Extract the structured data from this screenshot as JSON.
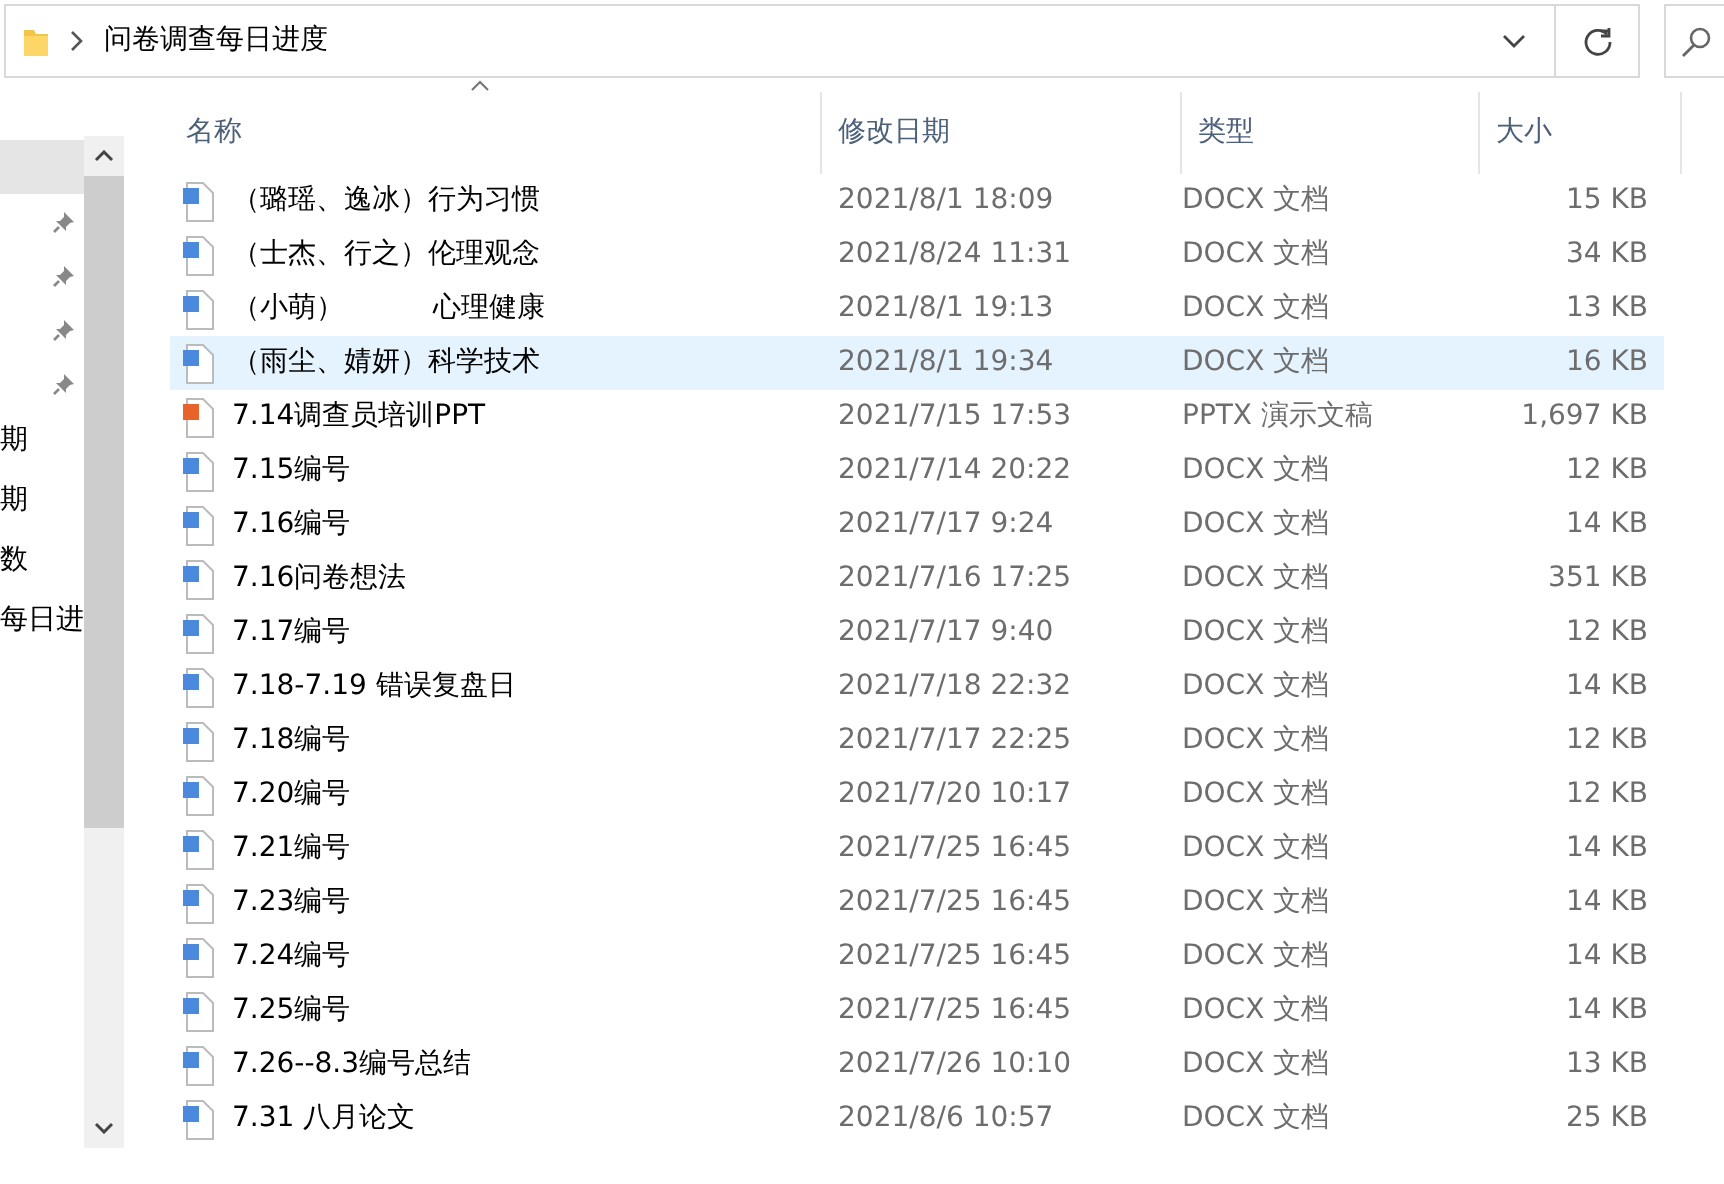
{
  "address_bar": {
    "path": "问卷调查每日进度"
  },
  "sidebar": {
    "items": [
      {
        "selected": true,
        "pinned": false
      },
      {
        "selected": false,
        "pinned": true
      },
      {
        "selected": false,
        "pinned": true
      },
      {
        "selected": false,
        "pinned": true
      },
      {
        "selected": false,
        "pinned": true
      },
      {
        "selected": false,
        "pinned": false,
        "label": "期"
      },
      {
        "selected": false,
        "pinned": false,
        "label": "期"
      },
      {
        "selected": false,
        "pinned": false,
        "label": "数"
      },
      {
        "selected": false,
        "pinned": false,
        "label": "每日进"
      }
    ]
  },
  "table": {
    "columns": [
      "名称",
      "修改日期",
      "类型",
      "大小"
    ],
    "rows": [
      {
        "kind": "docx",
        "name": "（璐瑶、逸冰）行为习惯",
        "modified": "2021/8/1 18:09",
        "type": "DOCX 文档",
        "size": "15 KB",
        "selected": false
      },
      {
        "kind": "docx",
        "name": "（士杰、行之）伦理观念",
        "modified": "2021/8/24 11:31",
        "type": "DOCX 文档",
        "size": "34 KB",
        "selected": false
      },
      {
        "kind": "docx",
        "name": "（小萌）          心理健康",
        "modified": "2021/8/1 19:13",
        "type": "DOCX 文档",
        "size": "13 KB",
        "selected": false
      },
      {
        "kind": "docx",
        "name": "（雨尘、婧妍）科学技术",
        "modified": "2021/8/1 19:34",
        "type": "DOCX 文档",
        "size": "16 KB",
        "selected": true
      },
      {
        "kind": "pptx",
        "name": "7.14调查员培训PPT",
        "modified": "2021/7/15 17:53",
        "type": "PPTX 演示文稿",
        "size": "1,697 KB",
        "selected": false
      },
      {
        "kind": "docx",
        "name": "7.15编号",
        "modified": "2021/7/14 20:22",
        "type": "DOCX 文档",
        "size": "12 KB",
        "selected": false
      },
      {
        "kind": "docx",
        "name": "7.16编号",
        "modified": "2021/7/17 9:24",
        "type": "DOCX 文档",
        "size": "14 KB",
        "selected": false
      },
      {
        "kind": "docx",
        "name": "7.16问卷想法",
        "modified": "2021/7/16 17:25",
        "type": "DOCX 文档",
        "size": "351 KB",
        "selected": false
      },
      {
        "kind": "docx",
        "name": "7.17编号",
        "modified": "2021/7/17 9:40",
        "type": "DOCX 文档",
        "size": "12 KB",
        "selected": false
      },
      {
        "kind": "docx",
        "name": "7.18-7.19 错误复盘日",
        "modified": "2021/7/18 22:32",
        "type": "DOCX 文档",
        "size": "14 KB",
        "selected": false
      },
      {
        "kind": "docx",
        "name": "7.18编号",
        "modified": "2021/7/17 22:25",
        "type": "DOCX 文档",
        "size": "12 KB",
        "selected": false
      },
      {
        "kind": "docx",
        "name": "7.20编号",
        "modified": "2021/7/20 10:17",
        "type": "DOCX 文档",
        "size": "12 KB",
        "selected": false
      },
      {
        "kind": "docx",
        "name": "7.21编号",
        "modified": "2021/7/25 16:45",
        "type": "DOCX 文档",
        "size": "14 KB",
        "selected": false
      },
      {
        "kind": "docx",
        "name": "7.23编号",
        "modified": "2021/7/25 16:45",
        "type": "DOCX 文档",
        "size": "14 KB",
        "selected": false
      },
      {
        "kind": "docx",
        "name": "7.24编号",
        "modified": "2021/7/25 16:45",
        "type": "DOCX 文档",
        "size": "14 KB",
        "selected": false
      },
      {
        "kind": "docx",
        "name": "7.25编号",
        "modified": "2021/7/25 16:45",
        "type": "DOCX 文档",
        "size": "14 KB",
        "selected": false
      },
      {
        "kind": "docx",
        "name": "7.26--8.3编号总结",
        "modified": "2021/7/26 10:10",
        "type": "DOCX 文档",
        "size": "13 KB",
        "selected": false
      },
      {
        "kind": "docx",
        "name": "7.31 八月论文",
        "modified": "2021/8/6 10:57",
        "type": "DOCX 文档",
        "size": "25 KB",
        "selected": false
      }
    ]
  }
}
